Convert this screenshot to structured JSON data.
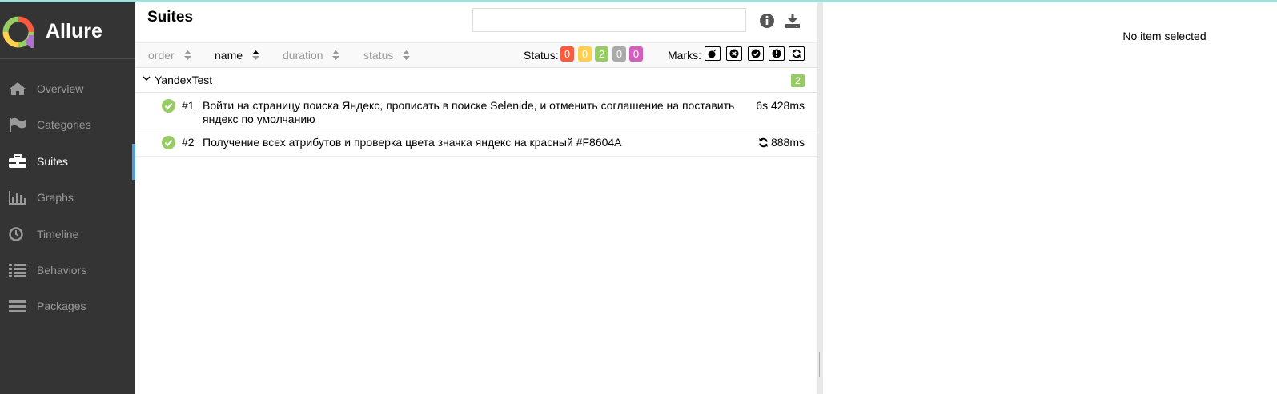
{
  "brand": {
    "name": "Allure"
  },
  "sidebar": {
    "items": [
      {
        "label": "Overview",
        "icon": "home-icon",
        "active": false
      },
      {
        "label": "Categories",
        "icon": "flag-icon",
        "active": false
      },
      {
        "label": "Suites",
        "icon": "briefcase-icon",
        "active": true
      },
      {
        "label": "Graphs",
        "icon": "bar-chart-icon",
        "active": false
      },
      {
        "label": "Timeline",
        "icon": "clock-icon",
        "active": false
      },
      {
        "label": "Behaviors",
        "icon": "list-icon",
        "active": false
      },
      {
        "label": "Packages",
        "icon": "lines-icon",
        "active": false
      }
    ]
  },
  "pane": {
    "title": "Suites",
    "search": {
      "value": "",
      "placeholder": ""
    },
    "tools": [
      "info-icon",
      "download-icon"
    ]
  },
  "sort": {
    "columns": [
      {
        "label": "order",
        "active": false
      },
      {
        "label": "name",
        "active": true,
        "direction": "asc"
      },
      {
        "label": "duration",
        "active": false
      },
      {
        "label": "status",
        "active": false
      }
    ]
  },
  "status_filter": {
    "label": "Status:",
    "badges": [
      {
        "status": "failed",
        "count": "0",
        "color": "#fd5a3e"
      },
      {
        "status": "broken",
        "count": "0",
        "color": "#ffd050"
      },
      {
        "status": "passed",
        "count": "2",
        "color": "#97cc64"
      },
      {
        "status": "skipped",
        "count": "0",
        "color": "#aaaaaa"
      },
      {
        "status": "unknown",
        "count": "0",
        "color": "#d35ebe"
      }
    ]
  },
  "marks": {
    "label": "Marks:",
    "buttons": [
      "bomb-icon",
      "times-circle-icon",
      "check-circle-icon",
      "exclamation-circle-icon",
      "refresh-icon"
    ]
  },
  "tree": {
    "group": {
      "name": "YandexTest",
      "count": "2"
    },
    "tests": [
      {
        "num": "#1",
        "name": "Войти на страницу поиска Яндекс, прописать в поиске Selenide, и отменить соглашение на поставить яндекс по умолчанию",
        "duration": "6s 428ms",
        "status": "passed",
        "retried": false
      },
      {
        "num": "#2",
        "name": "Получение всех атрибутов и проверка цвета значка яндекс на красный #F8604A",
        "duration": "888ms",
        "status": "passed",
        "retried": true
      }
    ]
  },
  "detail": {
    "empty_text": "No item selected"
  },
  "colors": {
    "sidebar_bg": "#343434",
    "accent": "#4f9ed9",
    "passed": "#97cc64"
  }
}
